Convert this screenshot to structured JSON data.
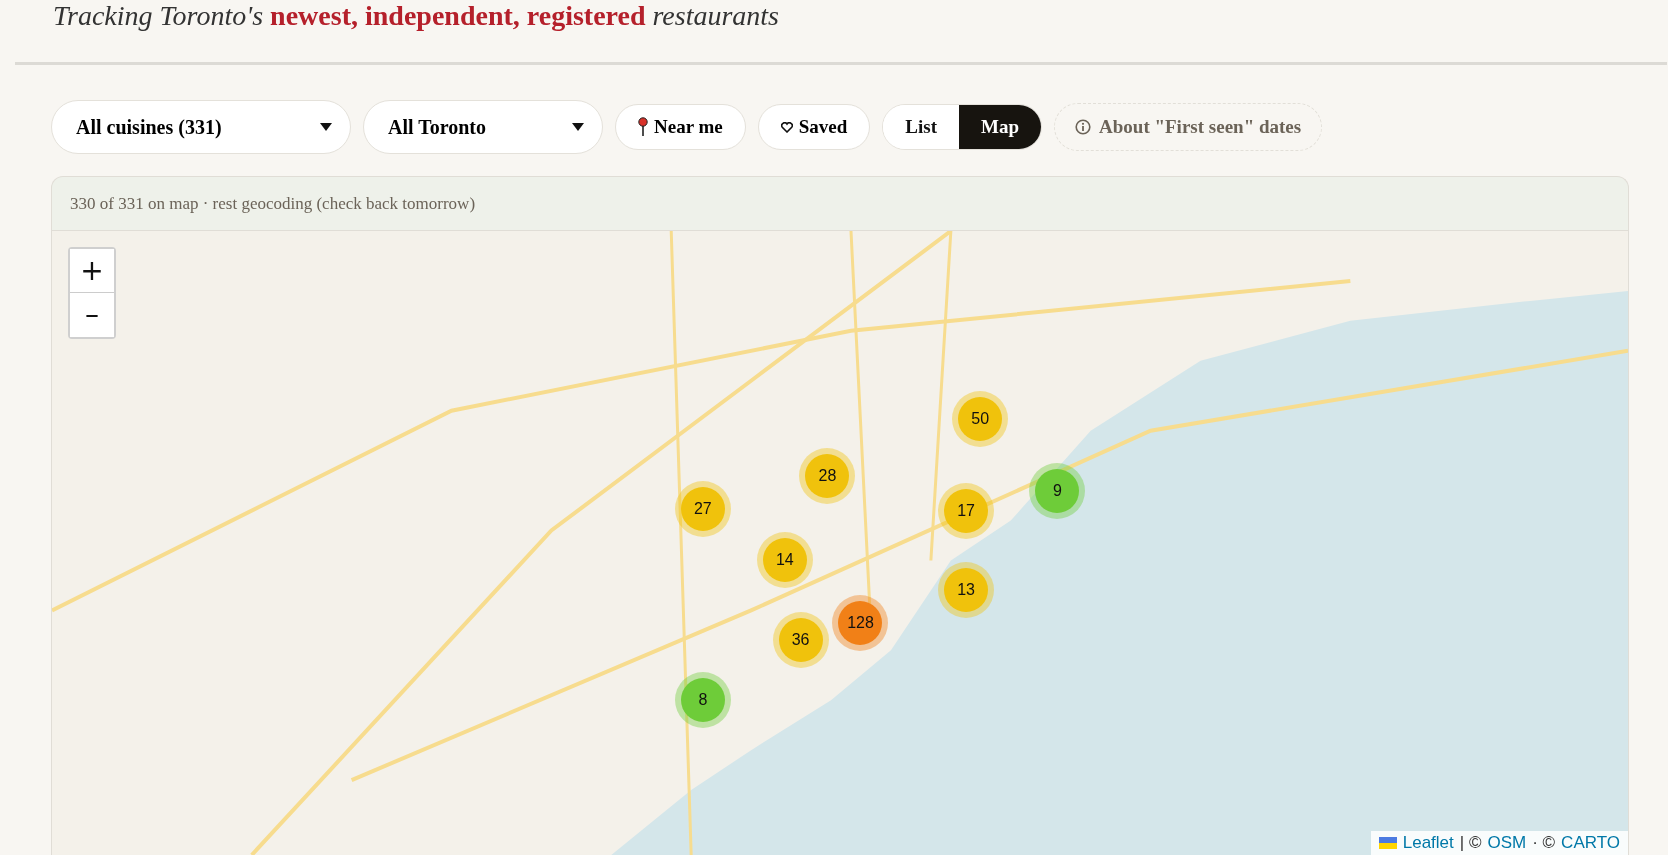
{
  "header": {
    "tagline": "*Tracking Toronto's* **newest, independent, registered** *restaurants*"
  },
  "filters": {
    "selects": [
      {
        "value": "All cuisines (331)"
      },
      {
        "value": "All Toronto"
      }
    ],
    "buttons": [
      {
        "kind": "pin",
        "label": "Near me"
      },
      {
        "kind": "heart",
        "label": "Saved"
      }
    ],
    "view_toggle": [
      {
        "label": "List",
        "selected": false
      },
      {
        "label": "Map",
        "selected": true
      }
    ],
    "info_button": {
      "label": "About \"First seen\" dates"
    }
  },
  "map_panel": {
    "status": "330 of 331 on map · rest geocoding (check back tomorrow)",
    "zoom_controls": [
      "+",
      "–"
    ],
    "clusters": [
      {
        "count": "50",
        "color": "#f0c20c"
      },
      {
        "count": "28",
        "color": "#f0c20c"
      },
      {
        "count": "27",
        "color": "#f0c20c"
      },
      {
        "count": "17",
        "color": "#f0c20c"
      },
      {
        "count": "9",
        "color": "#6ecc39"
      },
      {
        "count": "14",
        "color": "#f0c20c"
      },
      {
        "count": "13",
        "color": "#f0c20c"
      },
      {
        "count": "128",
        "color": "#f18017"
      },
      {
        "count": "36",
        "color": "#f0c20c"
      },
      {
        "count": "8",
        "color": "#6ecc39"
      }
    ],
    "attribution": [
      {
        "text": "Leaflet",
        "kind": "link"
      },
      {
        "text": "| ©",
        "kind": "text"
      },
      {
        "text": "OSM",
        "kind": "link"
      },
      {
        "text": "· ©",
        "kind": "text"
      },
      {
        "text": "CARTO",
        "kind": "link"
      }
    ]
  }
}
